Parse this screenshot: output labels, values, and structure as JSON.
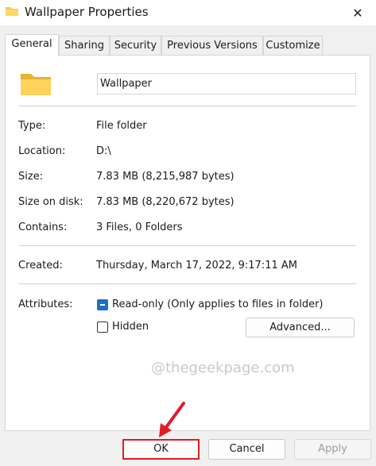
{
  "window": {
    "title": "Wallpaper Properties",
    "close_glyph": "✕"
  },
  "tabs": [
    {
      "label": "General",
      "active": true
    },
    {
      "label": "Sharing",
      "active": false
    },
    {
      "label": "Security",
      "active": false
    },
    {
      "label": "Previous Versions",
      "active": false
    },
    {
      "label": "Customize",
      "active": false
    }
  ],
  "general": {
    "name_value": "Wallpaper",
    "icon": "folder-icon",
    "properties": [
      {
        "label": "Type:",
        "value": "File folder"
      },
      {
        "label": "Location:",
        "value": "D:\\"
      },
      {
        "label": "Size:",
        "value": "7.83 MB (8,215,987 bytes)"
      },
      {
        "label": "Size on disk:",
        "value": "7.83 MB (8,220,672 bytes)"
      },
      {
        "label": "Contains:",
        "value": "3 Files, 0 Folders"
      }
    ],
    "created": {
      "label": "Created:",
      "value": "Thursday, March 17, 2022, 9:17:11 AM"
    },
    "attributes": {
      "label": "Attributes:",
      "readonly": {
        "label": "Read-only (Only applies to files in folder)",
        "state": "indeterminate"
      },
      "hidden": {
        "label": "Hidden",
        "checked": false
      },
      "advanced_label": "Advanced..."
    }
  },
  "watermark": "@thegeekpage.com",
  "buttons": {
    "ok": "OK",
    "cancel": "Cancel",
    "apply": "Apply"
  },
  "colors": {
    "accent": "#1f6fc4",
    "highlight": "#e31b23",
    "folder": "#f7c94b"
  }
}
